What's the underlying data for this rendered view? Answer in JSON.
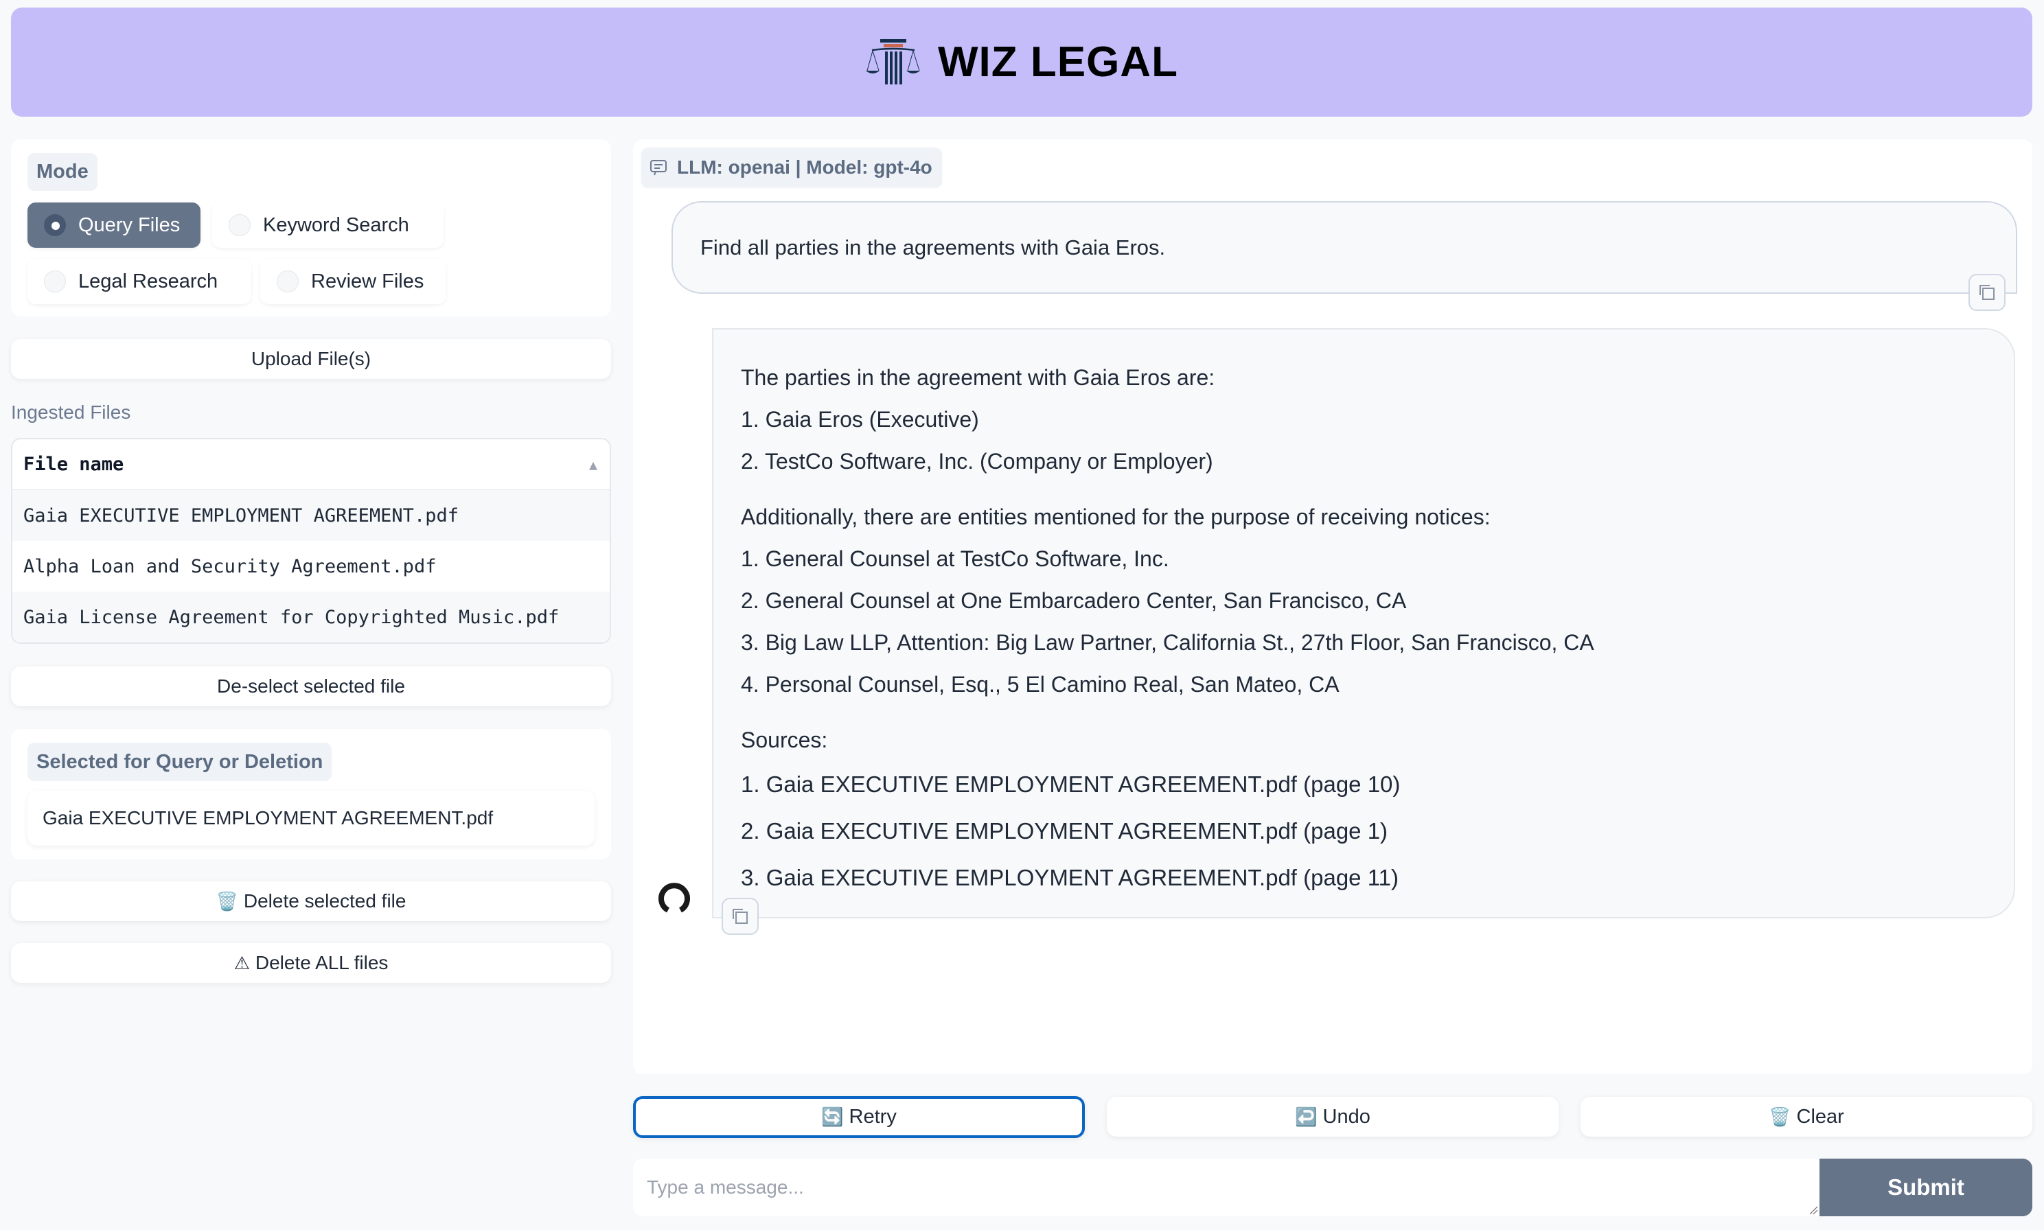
{
  "header": {
    "title": "WIZ LEGAL",
    "logo_icon": "courthouse-scales-icon",
    "background_color": "#c5bdfa"
  },
  "sidebar": {
    "mode": {
      "label": "Mode",
      "options": [
        {
          "label": "Query Files",
          "selected": true
        },
        {
          "label": "Keyword Search",
          "selected": false
        },
        {
          "label": "Legal Research",
          "selected": false
        },
        {
          "label": "Review Files",
          "selected": false
        }
      ]
    },
    "upload_label": "Upload File(s)",
    "ingested_label": "Ingested Files",
    "table": {
      "column": "File name",
      "sort_icon": "sort-ascending-icon",
      "rows": [
        "Gaia EXECUTIVE EMPLOYMENT AGREEMENT.pdf",
        "Alpha Loan and Security Agreement.pdf",
        "Gaia License Agreement for Copyrighted Music.pdf"
      ]
    },
    "deselect_label": "De-select selected file",
    "selected": {
      "label": "Selected for Query or Deletion",
      "value": "Gaia EXECUTIVE EMPLOYMENT AGREEMENT.pdf"
    },
    "delete_selected": {
      "icon": "🗑️",
      "label": "Delete selected file"
    },
    "delete_all": {
      "icon": "⚠",
      "label": "Delete ALL files"
    }
  },
  "chat": {
    "model_badge": "LLM: openai | Model: gpt-4o",
    "user_message": "Find all parties in the agreements with Gaia Eros.",
    "bot_message": {
      "intro": "The parties in the agreement with Gaia Eros are:",
      "parties": [
        "1. Gaia Eros (Executive)",
        "2. TestCo Software, Inc. (Company or Employer)"
      ],
      "notices_intro": "Additionally, there are entities mentioned for the purpose of receiving notices:",
      "notices": [
        "1. General Counsel at TestCo Software, Inc.",
        "2. General Counsel at One Embarcadero Center, San Francisco, CA",
        "3. Big Law LLP, Attention: Big Law Partner, California St., 27th Floor, San Francisco, CA",
        "4. Personal Counsel, Esq., 5 El Camino Real, San Mateo, CA"
      ],
      "sources_label": "Sources:",
      "sources": [
        "1. Gaia EXECUTIVE EMPLOYMENT AGREEMENT.pdf (page 10)",
        "2. Gaia EXECUTIVE EMPLOYMENT AGREEMENT.pdf (page 1)",
        "3. Gaia EXECUTIVE EMPLOYMENT AGREEMENT.pdf (page 11)"
      ]
    }
  },
  "actions": {
    "retry": {
      "icon": "🔄",
      "label": "Retry"
    },
    "undo": {
      "icon": "↩️",
      "label": "Undo"
    },
    "clear": {
      "icon": "🗑️",
      "label": "Clear"
    }
  },
  "input": {
    "placeholder": "Type a message...",
    "value": "",
    "submit_label": "Submit"
  }
}
